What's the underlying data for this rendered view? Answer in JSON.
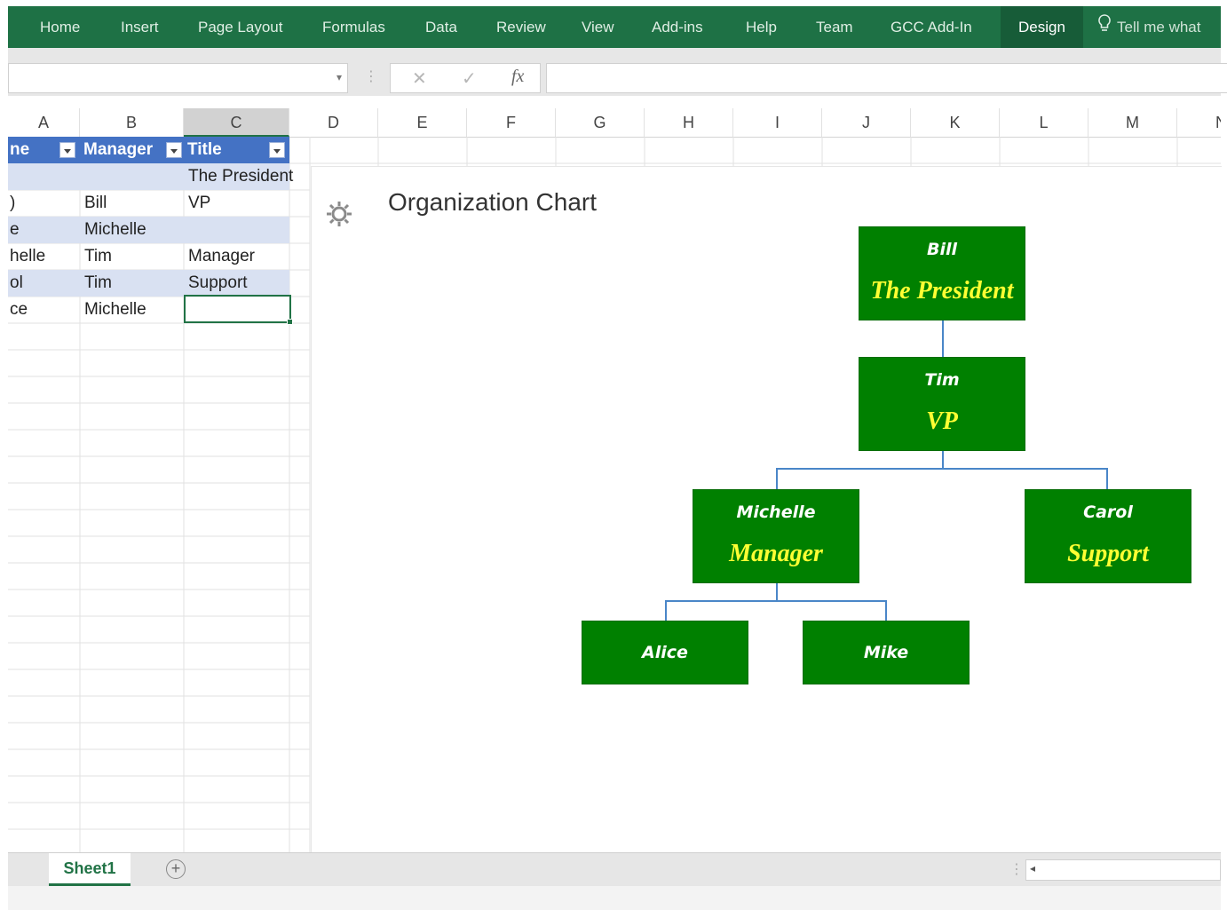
{
  "ribbon": {
    "tabs": [
      "Home",
      "Insert",
      "Page Layout",
      "Formulas",
      "Data",
      "Review",
      "View",
      "Add-ins",
      "Help",
      "Team",
      "GCC Add-In",
      "Design"
    ],
    "active_tab": "Design",
    "tell_me": "Tell me what"
  },
  "formula_bar": {
    "name_box": "",
    "fx_label": "fx",
    "value": ""
  },
  "columns": [
    "A",
    "B",
    "C",
    "D",
    "E",
    "F",
    "G",
    "H",
    "I",
    "J",
    "K",
    "L",
    "M",
    "N"
  ],
  "selected_column": "C",
  "table": {
    "headers": [
      "ne",
      "Manager",
      "Title"
    ],
    "rows": [
      [
        "",
        "",
        "The President"
      ],
      [
        ")",
        "Bill",
        "VP"
      ],
      [
        "e",
        "Michelle",
        ""
      ],
      [
        "helle",
        "Tim",
        "Manager"
      ],
      [
        "ol",
        "Tim",
        "Support"
      ],
      [
        "ce",
        "Michelle",
        ""
      ]
    ]
  },
  "chart": {
    "title": "Organization Chart",
    "nodes": {
      "bill": {
        "name": "Bill",
        "title": "The President"
      },
      "tim": {
        "name": "Tim",
        "title": "VP"
      },
      "michelle": {
        "name": "Michelle",
        "title": "Manager"
      },
      "carol": {
        "name": "Carol",
        "title": "Support"
      },
      "alice": {
        "name": "Alice",
        "title": ""
      },
      "mike": {
        "name": "Mike",
        "title": ""
      }
    },
    "colors": {
      "node_fill": "#008000",
      "name_text": "#ffffff",
      "title_text": "#ffff33",
      "connector": "#4a86c8"
    }
  },
  "sheet_tabs": [
    "Sheet1"
  ],
  "active_sheet": "Sheet1",
  "icons": [
    "settings-gear-icon",
    "lightbulb-icon",
    "cancel-icon",
    "confirm-icon",
    "add-sheet-icon",
    "filter-dropdown-icon",
    "scroll-left-icon"
  ]
}
